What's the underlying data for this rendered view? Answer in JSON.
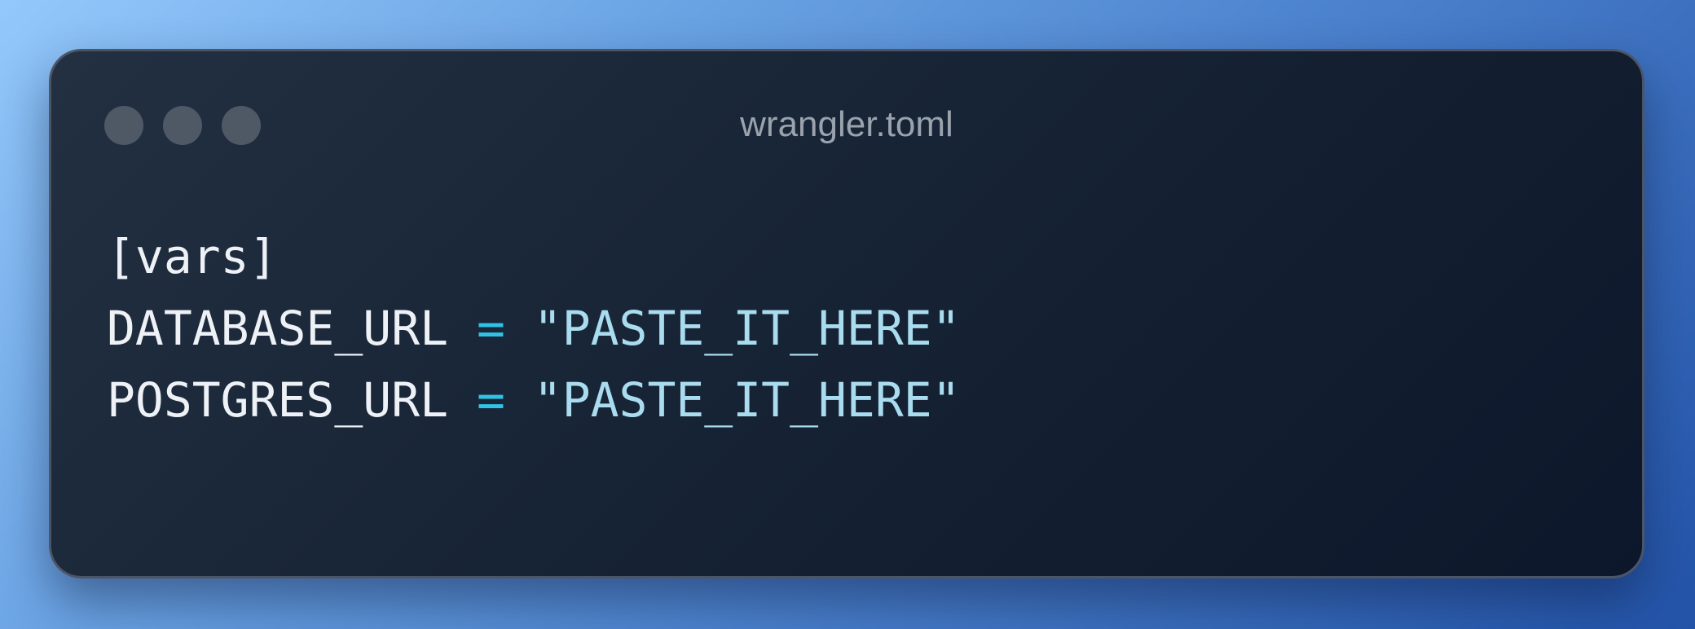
{
  "window": {
    "title": "wrangler.toml"
  },
  "code": {
    "lines": [
      {
        "section": "[vars]"
      },
      {
        "key": "DATABASE_URL",
        "op": "=",
        "value": "\"PASTE_IT_HERE\""
      },
      {
        "key": "POSTGRES_URL",
        "op": "=",
        "value": "\"PASTE_IT_HERE\""
      }
    ]
  },
  "colors": {
    "text": "#eef2f7",
    "operator": "#2fc4e6",
    "string": "#a9dcee",
    "title": "#9aa3ad"
  }
}
